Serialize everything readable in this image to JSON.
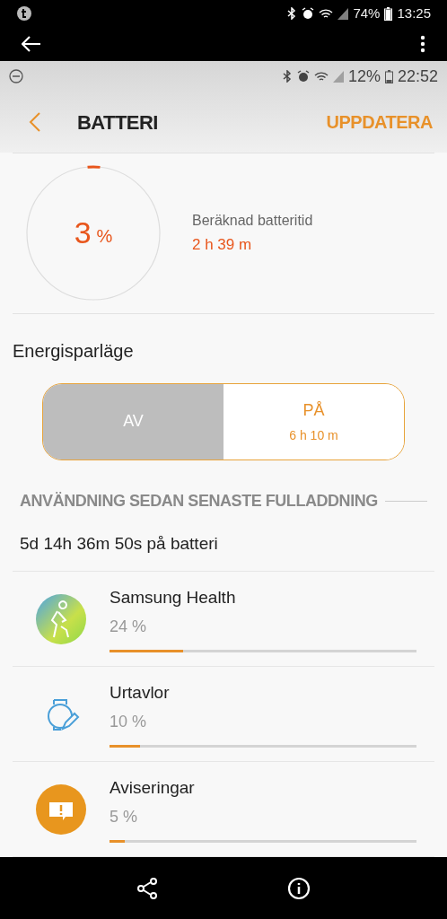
{
  "outer_status_bar": {
    "battery": "74%",
    "time": "13:25"
  },
  "inner_status_bar": {
    "battery": "12%",
    "time": "22:52"
  },
  "header": {
    "title": "BATTERI",
    "action": "UPPDATERA"
  },
  "battery": {
    "percent": "3",
    "unit": "%",
    "estimate_label": "Beräknad batteritid",
    "estimate_value": "2 h 39 m"
  },
  "power_saving": {
    "title": "Energisparläge",
    "options": [
      {
        "label": "AV",
        "selected": true
      },
      {
        "label": "PÅ",
        "detail": "6 h 10 m",
        "selected": false
      }
    ]
  },
  "usage": {
    "heading": "ANVÄNDNING SEDAN SENASTE FULLADDNING",
    "duration": "5d 14h 36m 50s på batteri",
    "apps": [
      {
        "name": "Samsung Health",
        "percent": "24 %",
        "level": 0.24,
        "kind": "health"
      },
      {
        "name": "Urtavlor",
        "percent": "10 %",
        "level": 0.1,
        "kind": "watch"
      },
      {
        "name": "Aviseringar",
        "percent": "5 %",
        "level": 0.05,
        "kind": "notification"
      }
    ]
  }
}
